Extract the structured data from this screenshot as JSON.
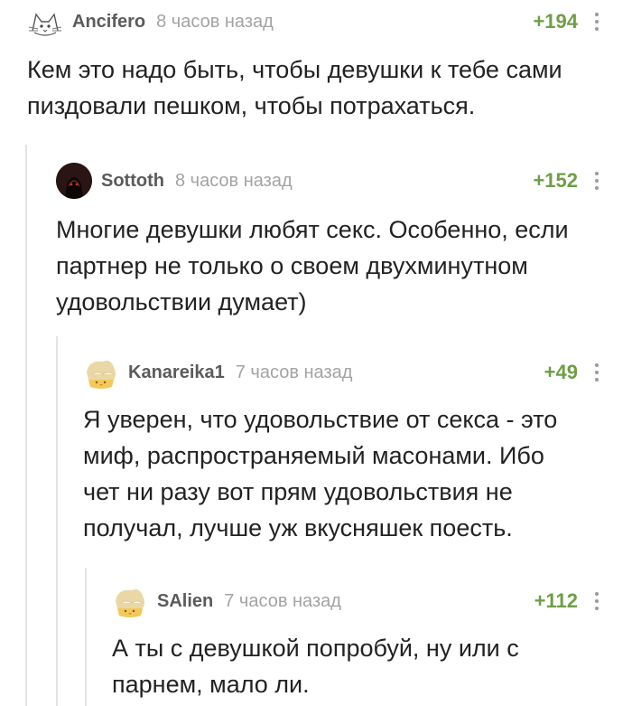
{
  "comments": [
    {
      "username": "Ancifero",
      "time": "8 часов назад",
      "rating": "+194",
      "avatar_icon": "cat-sketch-avatar-icon",
      "text": "Кем это надо быть, чтобы девушки к тебе сами\nпиздовали пешком, чтобы потрахаться."
    },
    {
      "username": "Sottoth",
      "time": "8 часов назад",
      "rating": "+152",
      "avatar_icon": "dark-figure-avatar-icon",
      "text": "Многие девушки любят секс. Особенно, если\nпартнер не только о своем двухминутном\nудовольствии думает)"
    },
    {
      "username": "Kanareika1",
      "time": "7 часов назад",
      "rating": "+49",
      "avatar_icon": "default-chick-avatar-icon",
      "text": "Я уверен, что удовольствие от секса - это\nмиф, распространяемый масонами. Ибо\nчет ни разу вот прям удовольствия не\nполучал, лучше уж вкусняшек поесть."
    },
    {
      "username": "SAlien",
      "time": "7 часов назад",
      "rating": "+112",
      "avatar_icon": "default-chick-avatar-icon",
      "text": "А ты с девушкой попробуй, ну или с\nпарнем, мало ли."
    }
  ],
  "colors": {
    "rating": "#6f9e45",
    "username": "#5b5b5b",
    "timestamp": "#a3a3a3",
    "thread_line": "#e3e3e3",
    "text": "#222222"
  }
}
